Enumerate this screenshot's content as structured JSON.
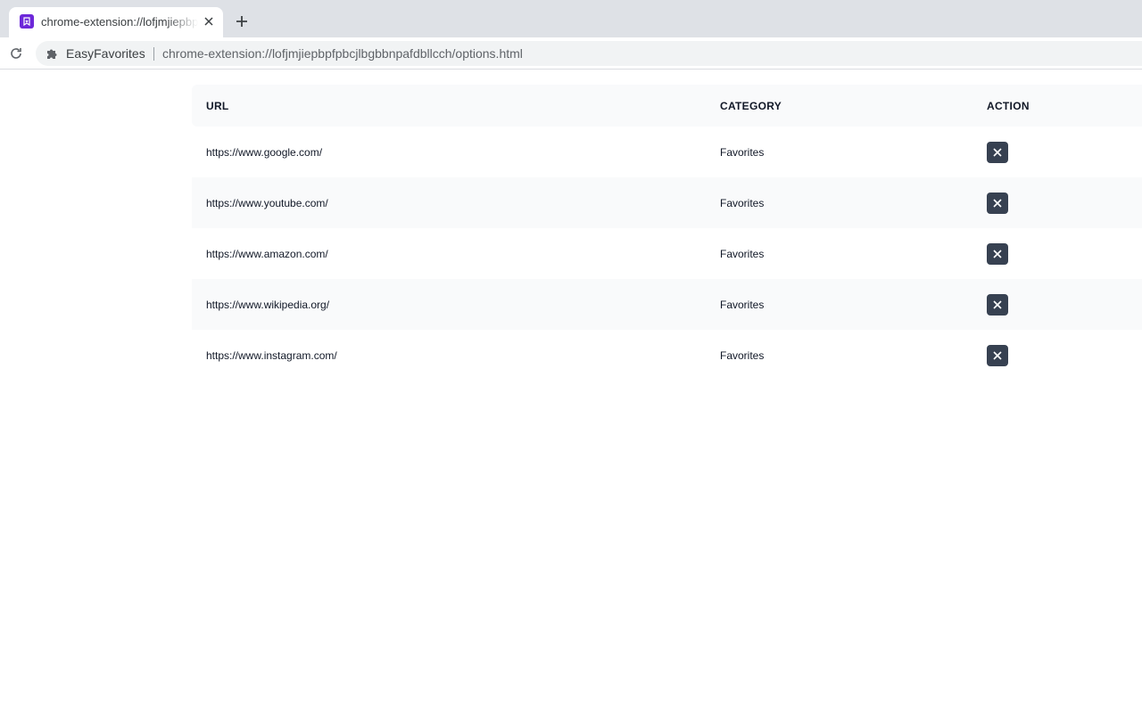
{
  "browser": {
    "tab_title": "chrome-extension://lofjmjiepbpfpbcjlbgbbnpafdbllcch/options.html",
    "site_name": "EasyFavorites",
    "url": "chrome-extension://lofjmjiepbpfpbcjlbgbbnpafdbllcch/options.html",
    "icons": {
      "favicon": "bookmark-star-icon",
      "tab_close": "close-icon",
      "new_tab": "plus-icon",
      "reload": "reload-icon",
      "extension": "puzzle-piece-icon"
    },
    "favicon_color": "#6d28d9"
  },
  "table": {
    "headers": {
      "url": "URL",
      "category": "CATEGORY",
      "action": "ACTION"
    },
    "rows": [
      {
        "url": "https://www.google.com/",
        "category": "Favorites"
      },
      {
        "url": "https://www.youtube.com/",
        "category": "Favorites"
      },
      {
        "url": "https://www.amazon.com/",
        "category": "Favorites"
      },
      {
        "url": "https://www.wikipedia.org/",
        "category": "Favorites"
      },
      {
        "url": "https://www.instagram.com/",
        "category": "Favorites"
      }
    ],
    "delete_icon": "close-icon",
    "delete_button_color": "#374151"
  }
}
